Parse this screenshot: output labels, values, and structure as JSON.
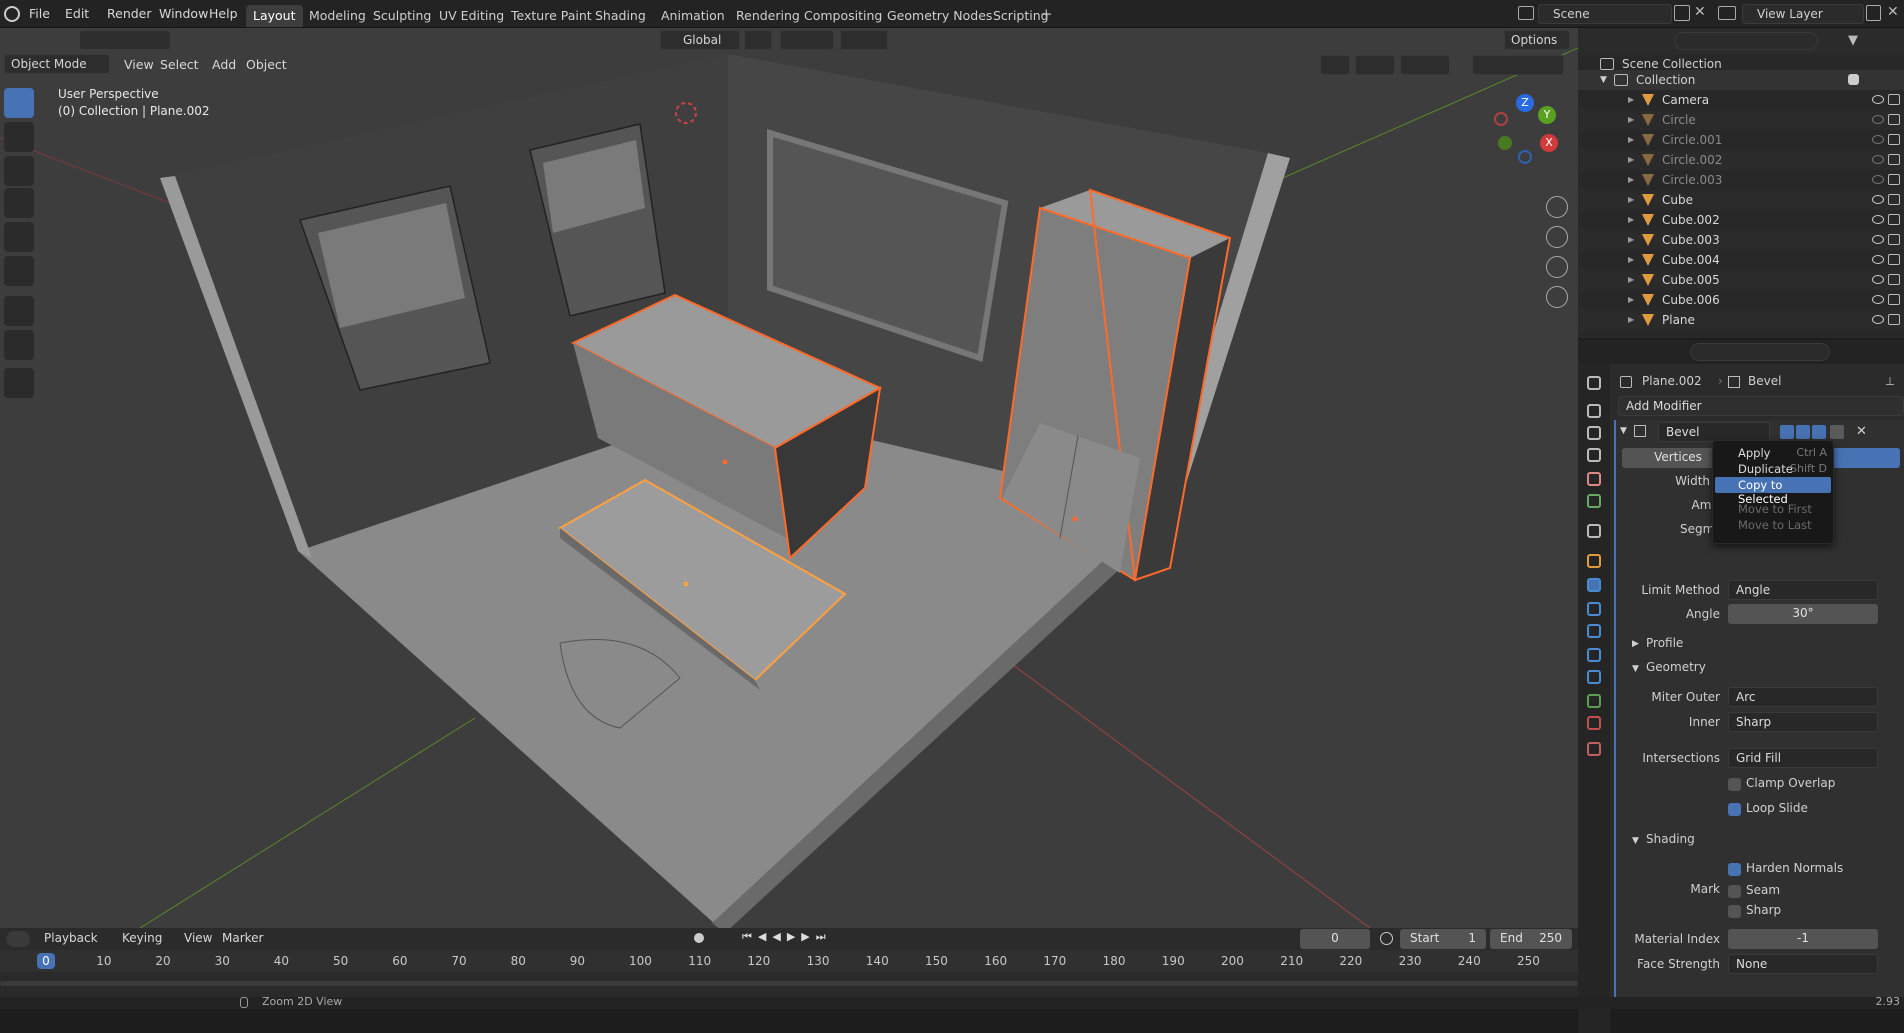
{
  "menubar": {
    "items": [
      "File",
      "Edit",
      "Render",
      "Window",
      "Help"
    ]
  },
  "workspaces": [
    "Layout",
    "Modeling",
    "Sculpting",
    "UV Editing",
    "Texture Paint",
    "Shading",
    "Animation",
    "Rendering",
    "Compositing",
    "Geometry Nodes",
    "Scripting"
  ],
  "scene_name": "Scene",
  "view_layer": "View Layer",
  "viewport": {
    "mode": "Object Mode",
    "menus": [
      "View",
      "Select",
      "Add",
      "Object"
    ],
    "transform": "Global",
    "options": "Options",
    "overlay_title": "User Perspective",
    "overlay_subtitle": "(0) Collection | Plane.002",
    "gizmo": {
      "x": "X",
      "y": "Y",
      "z": "Z"
    }
  },
  "outliner": {
    "root": "Scene Collection",
    "collection": "Collection",
    "items": [
      {
        "name": "Camera",
        "dim": false
      },
      {
        "name": "Circle",
        "dim": true
      },
      {
        "name": "Circle.001",
        "dim": true
      },
      {
        "name": "Circle.002",
        "dim": true
      },
      {
        "name": "Circle.003",
        "dim": true
      },
      {
        "name": "Cube",
        "dim": false
      },
      {
        "name": "Cube.002",
        "dim": false
      },
      {
        "name": "Cube.003",
        "dim": false
      },
      {
        "name": "Cube.004",
        "dim": false
      },
      {
        "name": "Cube.005",
        "dim": false
      },
      {
        "name": "Cube.006",
        "dim": false
      },
      {
        "name": "Plane",
        "dim": false
      }
    ]
  },
  "properties": {
    "object": "Plane.002",
    "modifier_crumb": "Bevel",
    "add_modifier": "Add Modifier",
    "modifier_name": "Bevel",
    "vertices": "Vertices",
    "width_type": "Width Typ",
    "amount": "Amoun",
    "segments": "Segment",
    "limit_method_label": "Limit Method",
    "limit_method": "Angle",
    "angle_label": "Angle",
    "angle": "30°",
    "profile": "Profile",
    "geometry": "Geometry",
    "miter_outer_label": "Miter Outer",
    "miter_outer": "Arc",
    "inner_label": "Inner",
    "inner": "Sharp",
    "intersections_label": "Intersections",
    "intersections": "Grid Fill",
    "clamp_overlap": "Clamp Overlap",
    "loop_slide": "Loop Slide",
    "shading": "Shading",
    "harden_normals": "Harden Normals",
    "mark_label": "Mark",
    "seam": "Seam",
    "sharp": "Sharp",
    "material_index_label": "Material Index",
    "material_index": "-1",
    "face_strength_label": "Face Strength",
    "face_strength": "None"
  },
  "context_menu": {
    "items": [
      {
        "label": "Apply",
        "shortcut": "Ctrl A",
        "enabled": true
      },
      {
        "label": "Duplicate",
        "shortcut": "Shift D",
        "enabled": true
      },
      {
        "label": "Copy to Selected",
        "shortcut": "",
        "enabled": true,
        "highlight": true
      },
      {
        "label": "Move to First",
        "shortcut": "",
        "enabled": false
      },
      {
        "label": "Move to Last",
        "shortcut": "",
        "enabled": false
      }
    ]
  },
  "timeline": {
    "menus": [
      "Playback",
      "Keying",
      "View",
      "Marker"
    ],
    "current_frame": "0",
    "start_label": "Start",
    "start": "1",
    "end_label": "End",
    "end": "250",
    "ruler": [
      "0",
      "10",
      "20",
      "30",
      "40",
      "50",
      "60",
      "70",
      "80",
      "90",
      "100",
      "110",
      "120",
      "130",
      "140",
      "150",
      "160",
      "170",
      "180",
      "190",
      "200",
      "210",
      "220",
      "230",
      "240",
      "250"
    ]
  },
  "statusbar": {
    "hint": "Zoom 2D View",
    "version": "2.93"
  }
}
